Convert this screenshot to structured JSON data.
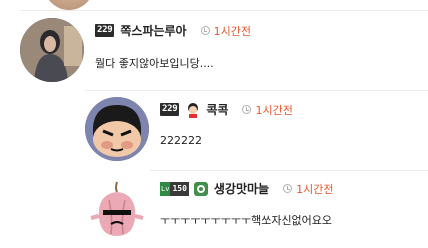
{
  "comments": [
    {
      "level": "229",
      "nickname": "쪽스파는루아",
      "time": "1시간전",
      "text": "뭘다 좋지않아보입니당...."
    },
    {
      "level": "229",
      "nickname": "콕콕",
      "time": "1시간전",
      "text": "222222"
    },
    {
      "level_prefix": "Lv",
      "level": "150",
      "nickname": "생강맛마늘",
      "time": "1시간전",
      "text": "ㅜㅜㅜㅜㅜㅜㅜㅜㅜ핵쏘자신없어요오"
    }
  ],
  "colors": {
    "time": "#e8582a",
    "separator": "#ececec",
    "badge": "#2b2b2b"
  },
  "icons": [
    "clock-icon",
    "character-emblem-icon",
    "level-badge-icon"
  ]
}
